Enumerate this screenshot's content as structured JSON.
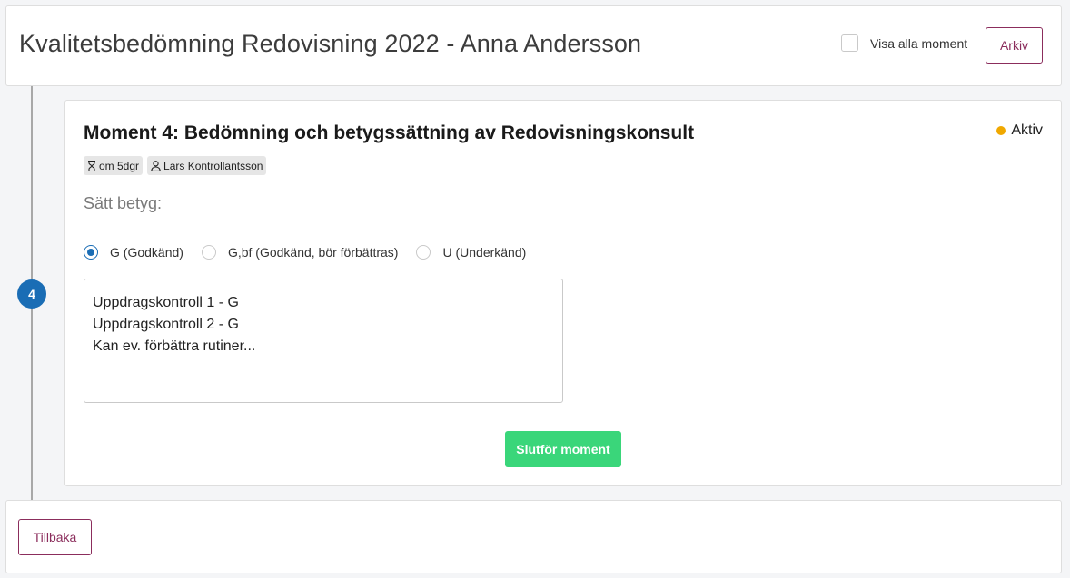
{
  "header": {
    "title": "Kvalitetsbedömning Redovisning 2022 - Anna Andersson",
    "show_all_label": "Visa alla moment",
    "show_all_checked": false,
    "archive_label": "Arkiv"
  },
  "timeline": {
    "step_number": "4"
  },
  "moment": {
    "title": "Moment 4: Bedömning och betygssättning av Redovisningskonsult",
    "status": "Aktiv",
    "status_color": "#f0a800",
    "due_badge": "om 5dgr",
    "due_icon": "hourglass-icon",
    "assignee_badge": "Lars Kontrollantsson",
    "assignee_icon": "user-icon",
    "grade_label": "Sätt betyg:",
    "grade_options": [
      {
        "label": "G (Godkänd)",
        "checked": true
      },
      {
        "label": "G,bf (Godkänd, bör förbättras)",
        "checked": false
      },
      {
        "label": "U (Underkänd)",
        "checked": false
      }
    ],
    "comment": "Uppdragskontroll 1 - G\nUppdragskontroll 2 - G\nKan ev. förbättra rutiner...",
    "complete_label": "Slutför moment"
  },
  "footer": {
    "back_label": "Tillbaka"
  },
  "colors": {
    "accent": "#8b2d5c",
    "primary": "#1a6db5",
    "success": "#3ad67a"
  }
}
